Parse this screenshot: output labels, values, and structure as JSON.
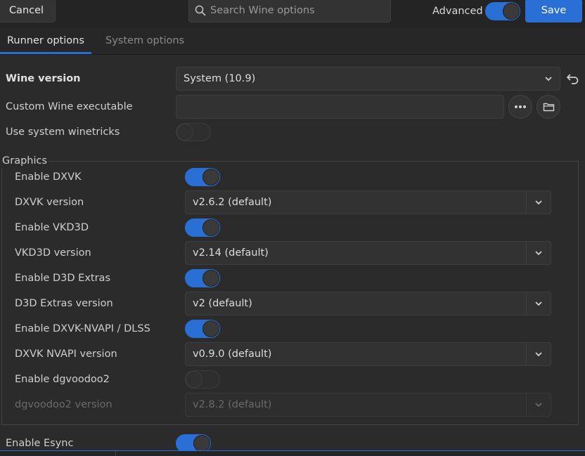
{
  "header": {
    "cancel_label": "Cancel",
    "search_placeholder": "Search Wine options",
    "advanced_label": "Advanced",
    "advanced_on": true,
    "save_label": "Save"
  },
  "tabs": [
    {
      "label": "Runner options",
      "active": true
    },
    {
      "label": "System options",
      "active": false
    }
  ],
  "runner": {
    "wine_version": {
      "label": "Wine version",
      "value": "System (10.9)"
    },
    "custom_exe": {
      "label": "Custom Wine executable",
      "value": ""
    },
    "system_winetricks": {
      "label": "Use system winetricks",
      "on": false
    }
  },
  "graphics": {
    "title": "Graphics",
    "enable_dxvk": {
      "label": "Enable DXVK",
      "on": true
    },
    "dxvk_version": {
      "label": "DXVK version",
      "value": "v2.6.2 (default)"
    },
    "enable_vkd3d": {
      "label": "Enable VKD3D",
      "on": true
    },
    "vkd3d_version": {
      "label": "VKD3D version",
      "value": "v2.14 (default)"
    },
    "enable_d3d_extras": {
      "label": "Enable D3D Extras",
      "on": true
    },
    "d3d_extras_version": {
      "label": "D3D Extras version",
      "value": "v2 (default)"
    },
    "enable_nvapi": {
      "label": "Enable DXVK-NVAPI / DLSS",
      "on": true
    },
    "nvapi_version": {
      "label": "DXVK NVAPI version",
      "value": "v0.9.0 (default)"
    },
    "enable_dgvoodoo2": {
      "label": "Enable dgvoodoo2",
      "on": false
    },
    "dgvoodoo2_version": {
      "label": "dgvoodoo2 version",
      "value": "v2.8.2 (default)"
    }
  },
  "esync": {
    "label": "Enable Esync",
    "on": true
  },
  "colors": {
    "accent": "#2a6fd6",
    "background": "#2b2b2b"
  },
  "icons": {
    "search": "search-icon",
    "chevron": "chevron-down-icon",
    "reset": "undo-icon",
    "more": "ellipsis-icon",
    "folder": "folder-icon"
  }
}
